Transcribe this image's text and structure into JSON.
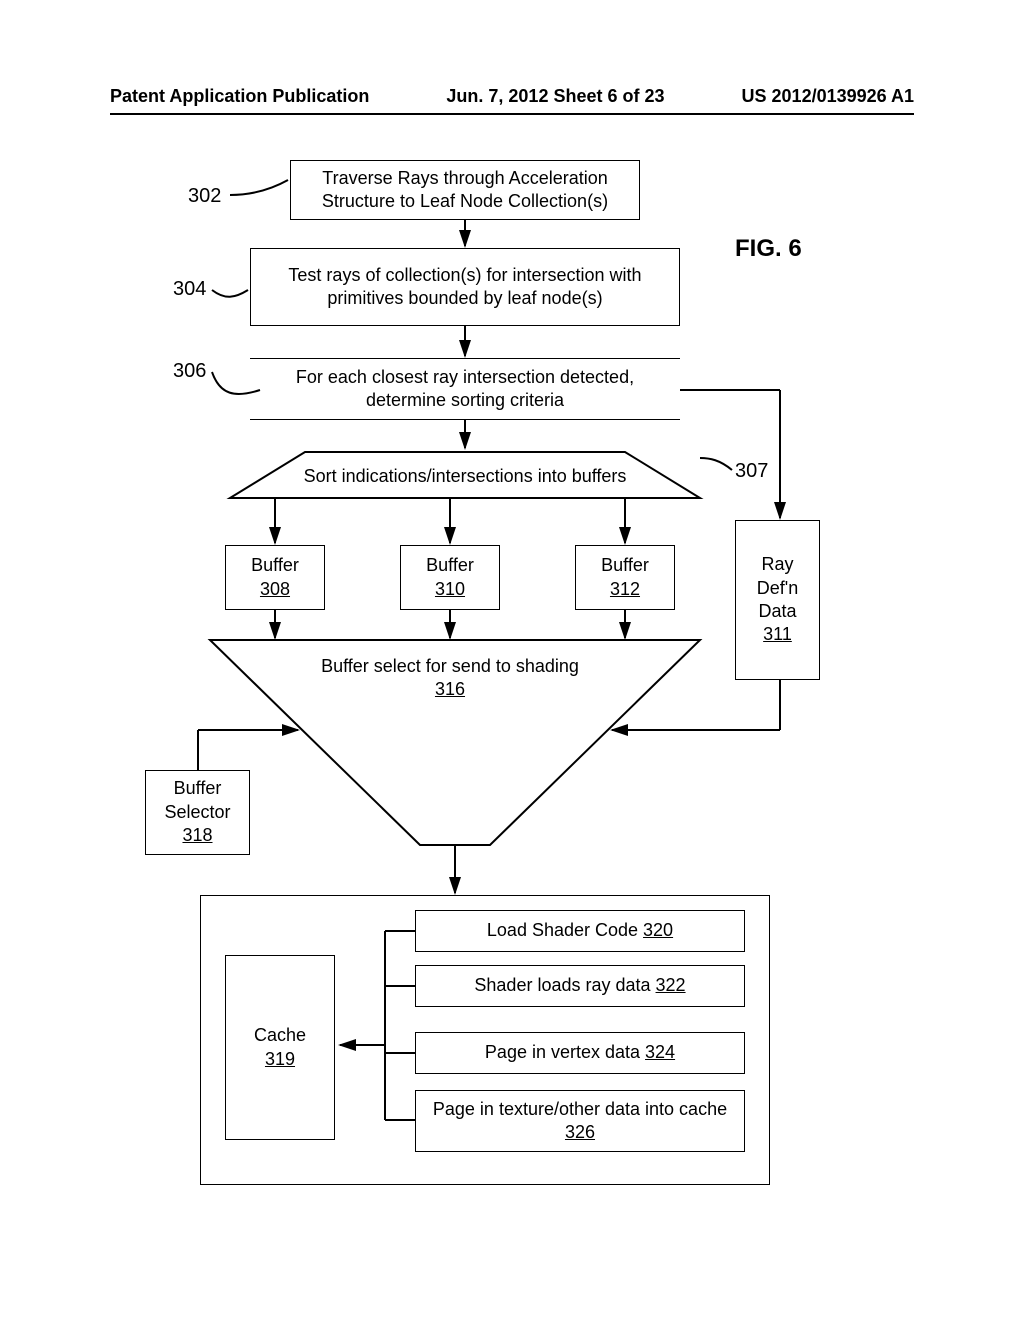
{
  "header": {
    "left": "Patent Application Publication",
    "center": "Jun. 7, 2012   Sheet 6 of 23",
    "right": "US 2012/0139926 A1"
  },
  "figure_label": "FIG. 6",
  "refs": {
    "r302": "302",
    "r304": "304",
    "r306": "306",
    "r307": "307"
  },
  "blocks": {
    "b302": "Traverse Rays through Acceleration Structure to Leaf Node Collection(s)",
    "b304": "Test rays of collection(s) for intersection with primitives bounded by leaf node(s)",
    "b306": "For each closest ray intersection detected, determine sorting criteria",
    "b307": "Sort indications/intersections into buffers",
    "buffer308_label": "Buffer",
    "buffer308_num": "308",
    "buffer310_label": "Buffer",
    "buffer310_num": "310",
    "buffer312_label": "Buffer",
    "buffer312_num": "312",
    "raydefn_l1": "Ray",
    "raydefn_l2": "Def'n",
    "raydefn_l3": "Data",
    "raydefn_num": "311",
    "b316_label": "Buffer select for send to shading",
    "b316_num": "316",
    "b318_l1": "Buffer",
    "b318_l2": "Selector",
    "b318_num": "318",
    "cache_label": "Cache",
    "cache_num": "319",
    "s320_text": "Load Shader Code ",
    "s320_num": "320",
    "s322_text": "Shader loads ray data ",
    "s322_num": "322",
    "s324_text": "Page in vertex data ",
    "s324_num": "324",
    "s326_text": "Page in texture/other data into cache ",
    "s326_num": "326"
  }
}
